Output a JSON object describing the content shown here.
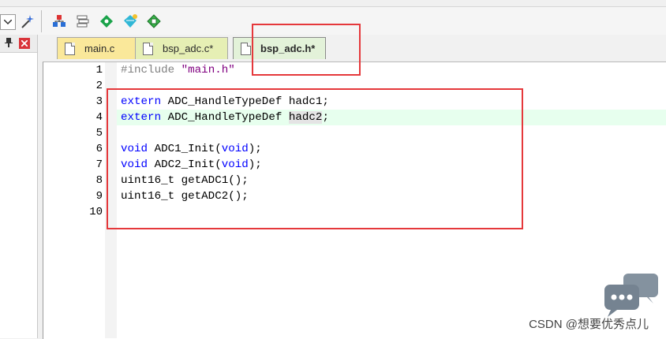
{
  "tabs": [
    {
      "label": "main.c",
      "active": false
    },
    {
      "label": "bsp_adc.c*",
      "active": false
    },
    {
      "label": "bsp_adc.h*",
      "active": true
    }
  ],
  "editor": {
    "lines": [
      {
        "number": "1",
        "text": "#include \"main.h\""
      },
      {
        "number": "2",
        "text": ""
      },
      {
        "number": "3",
        "text": "extern ADC_HandleTypeDef hadc1;"
      },
      {
        "number": "4",
        "text": "extern ADC_HandleTypeDef hadc2;"
      },
      {
        "number": "5",
        "text": ""
      },
      {
        "number": "6",
        "text": "void ADC1_Init(void);"
      },
      {
        "number": "7",
        "text": "void ADC2_Init(void);"
      },
      {
        "number": "8",
        "text": "uint16_t getADC1();"
      },
      {
        "number": "9",
        "text": "uint16_t getADC2();"
      },
      {
        "number": "10",
        "text": ""
      }
    ],
    "highlighted_line": "4"
  },
  "tokens": {
    "l1_pp": "#include",
    "l1_str": "\"main.h\"",
    "l3_kw": "extern",
    "l3_rest": " ADC_HandleTypeDef hadc1;",
    "l4_kw": "extern",
    "l4_mid": " ADC_HandleTypeDef ",
    "l4_var": "hadc2",
    "l4_end": ";",
    "l6_kw": "void",
    "l6_mid": " ADC1_Init(",
    "l6_kw2": "void",
    "l6_end": ");",
    "l7_kw": "void",
    "l7_mid": " ADC2_Init(",
    "l7_kw2": "void",
    "l7_end": ");",
    "l8": "uint16_t getADC1();",
    "l9": "uint16_t getADC2();"
  },
  "watermark": "CSDN @想要优秀点儿",
  "colors": {
    "annotation": "#e5383b",
    "keyword": "#0000ff",
    "string": "#800080",
    "current_line": "#e7ffee"
  }
}
